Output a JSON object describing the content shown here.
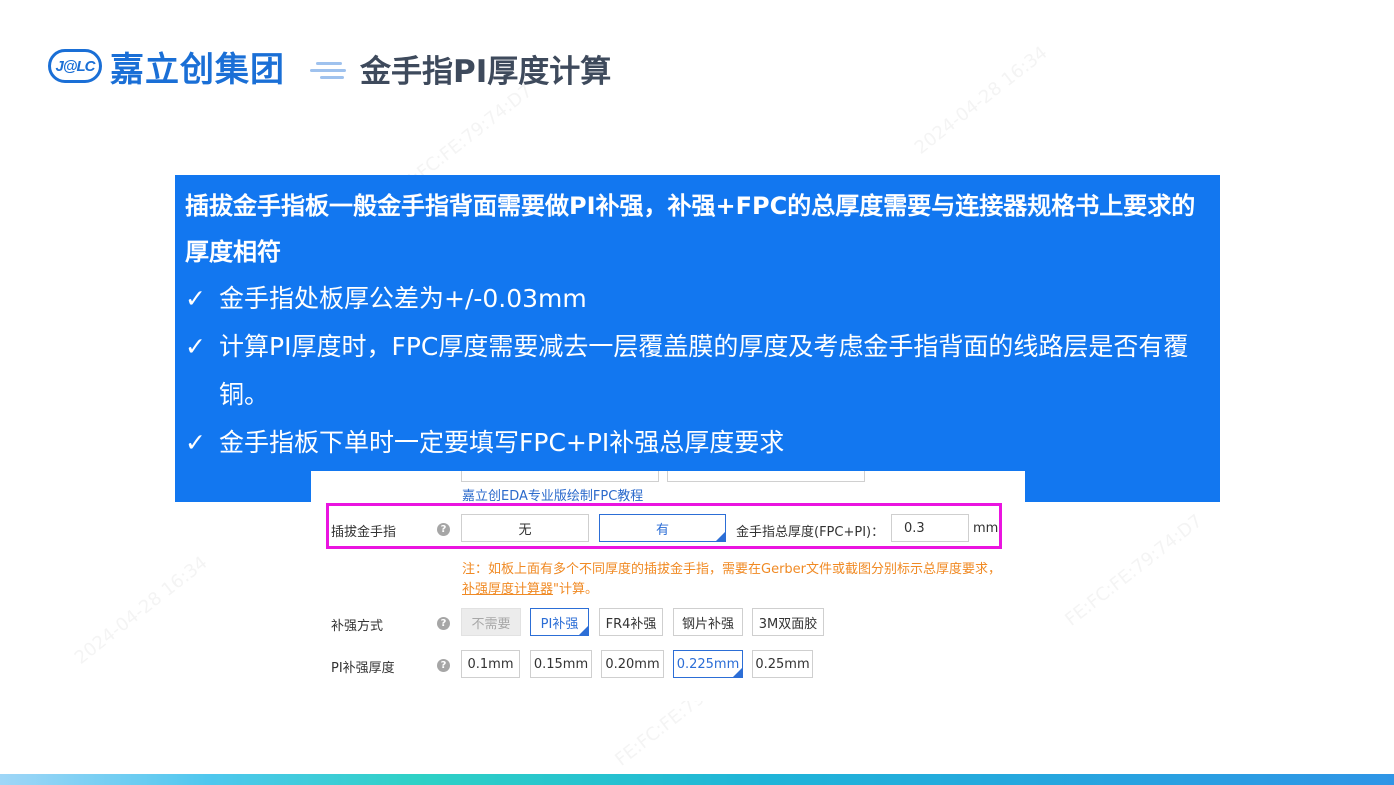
{
  "header": {
    "logo_badge": "J@LC",
    "logo_text": "嘉立创集团",
    "title": "金手指PI厚度计算"
  },
  "note": {
    "heading": "插拔金手指板一般金手指背面需要做PI补强，补强+FPC的总厚度需要与连接器规格书上要求的厚度相符",
    "check_glyph": "✓",
    "items": [
      {
        "text": "金手指处板厚公差为+/-0.03mm"
      },
      {
        "text": "计算PI厚度时，FPC厚度需要减去一层覆盖膜的厚度及考虑金手指背面的线路层是否有覆铜。"
      },
      {
        "text": "金手指板下单时一定要填写FPC+PI补强总厚度要求"
      }
    ]
  },
  "form": {
    "eda_link": "嘉立创EDA专业版绘制FPC教程",
    "help_glyph": "?",
    "gold_finger": {
      "label": "插拔金手指",
      "options": [
        "无",
        "有"
      ],
      "selected": "有",
      "total_label": "金手指总厚度(FPC+PI)：",
      "total_value": "0.3",
      "unit": "mm"
    },
    "warning": {
      "line1": "注：如板上面有多个不同厚度的插拔金手指，需要在Gerber文件或截图分别标示总厚度要求，",
      "link": "补强厚度计算器",
      "line2_suffix": "\"计算。"
    },
    "reinforce": {
      "label": "补强方式",
      "options": [
        "不需要",
        "PI补强",
        "FR4补强",
        "钢片补强",
        "3M双面胶"
      ],
      "selected": "PI补强",
      "disabled": "不需要"
    },
    "pi_thickness": {
      "label": "PI补强厚度",
      "options": [
        "0.1mm",
        "0.15mm",
        "0.20mm",
        "0.225mm",
        "0.25mm"
      ],
      "selected": "0.225mm"
    }
  },
  "colors": {
    "brand_blue": "#1a6fd6",
    "note_bg": "#1277f0",
    "highlight": "#ea14e0",
    "warning": "#f08a24"
  }
}
